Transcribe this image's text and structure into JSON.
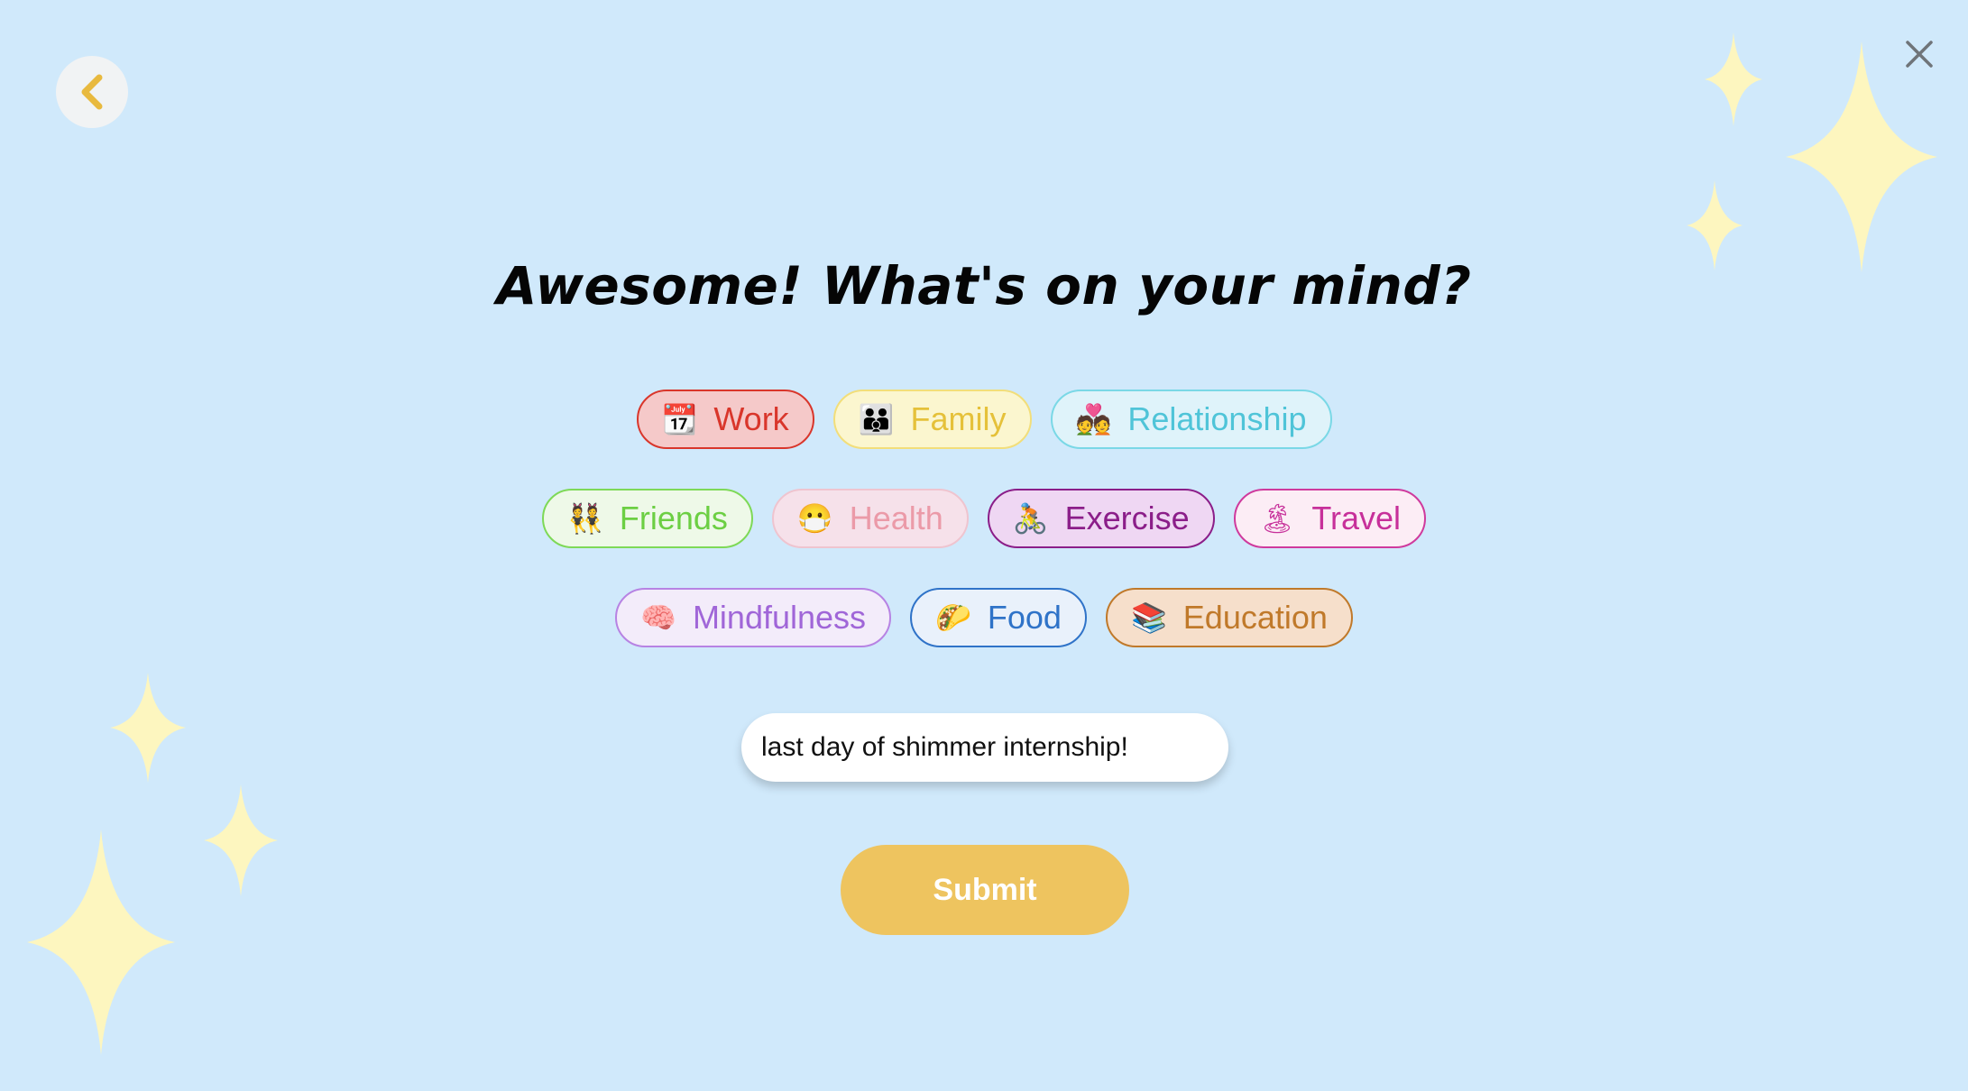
{
  "header": {
    "back_icon": "chevron-left-icon",
    "close_icon": "close-icon",
    "title": "Awesome! What's on your mind?"
  },
  "topics": {
    "rows": [
      [
        {
          "emoji": "📆",
          "label": "Work",
          "color": "#d9362b",
          "bg": "#f5c9c9",
          "border": "#d9362b"
        },
        {
          "emoji": "👪",
          "label": "Family",
          "color": "#e5c13a",
          "bg": "#fbf6cf",
          "border": "#f2de7a"
        },
        {
          "emoji": "💑",
          "label": "Relationship",
          "color": "#4fc4d8",
          "bg": "#dff3fa",
          "border": "#7ad8e6"
        }
      ],
      [
        {
          "emoji": "👯",
          "label": "Friends",
          "color": "#6ccf43",
          "bg": "#eef9e8",
          "border": "#7ed957"
        },
        {
          "emoji": "😷",
          "label": "Health",
          "color": "#eb9aa8",
          "bg": "#f6e1ea",
          "border": "#efc4cf"
        },
        {
          "emoji": "🚴",
          "label": "Exercise",
          "color": "#8b1e89",
          "bg": "#efd7f3",
          "border": "#8b1e89"
        },
        {
          "emoji": "🏝",
          "label": "Travel",
          "color": "#c7309a",
          "bg": "#fcedf5",
          "border": "#cf3a9d"
        }
      ],
      [
        {
          "emoji": "🧠",
          "label": "Mindfulness",
          "color": "#a066d8",
          "bg": "#f3ecfa",
          "border": "#b783e3"
        },
        {
          "emoji": "🌮",
          "label": "Food",
          "color": "#2f73c8",
          "bg": "#e9f1fb",
          "border": "#2f73c8"
        },
        {
          "emoji": "📚",
          "label": "Education",
          "color": "#c0792a",
          "bg": "#f6dfcb",
          "border": "#c0792a"
        }
      ]
    ]
  },
  "entry": {
    "value": "last day of shimmer internship!"
  },
  "submit_label": "Submit",
  "colors": {
    "background": "#d0e9fb",
    "accent": "#eec45f",
    "sparkle": "#fdf6bf"
  }
}
